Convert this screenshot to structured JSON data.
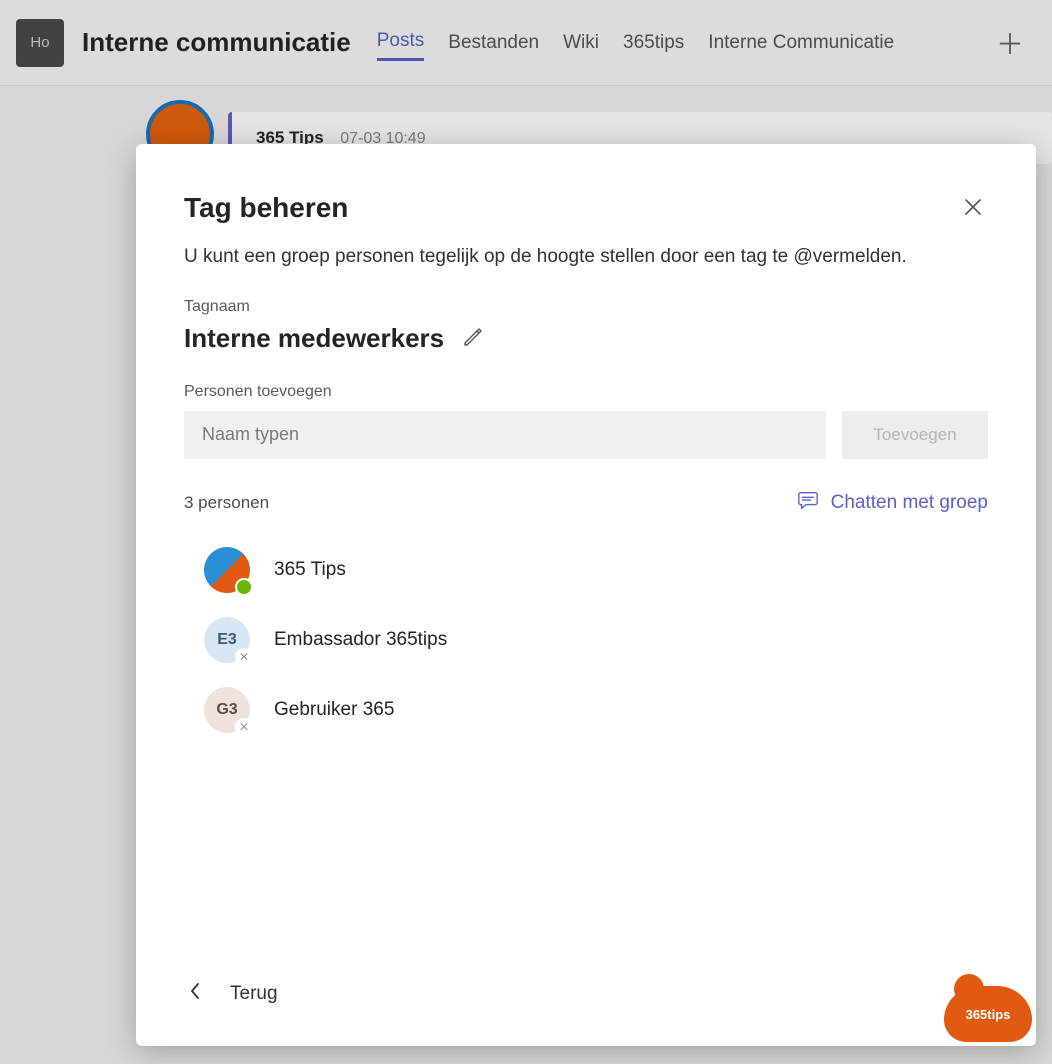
{
  "header": {
    "team_avatar_initials": "Ho",
    "channel_title": "Interne communicatie",
    "tabs": [
      "Posts",
      "Bestanden",
      "Wiki",
      "365tips",
      "Interne Communicatie"
    ],
    "active_tab_index": 0
  },
  "bg_message": {
    "author": "365 Tips",
    "timestamp": "07-03 10:49"
  },
  "modal": {
    "title": "Tag beheren",
    "subtitle": "U kunt een groep personen tegelijk op de hoogte stellen door een tag te @vermelden.",
    "tagname_label": "Tagnaam",
    "tagname_value": "Interne medewerkers",
    "add_people_label": "Personen toevoegen",
    "name_input_placeholder": "Naam typen",
    "add_button_label": "Toevoegen",
    "people_count_text": "3 personen",
    "chat_with_group_label": "Chatten met groep",
    "people": [
      {
        "name": "365 Tips",
        "initials": "",
        "avatar_class": "p-av-tips",
        "presence": "available",
        "presence_glyph": ""
      },
      {
        "name": "Embassador 365tips",
        "initials": "E3",
        "avatar_class": "p-av-e3",
        "presence": "offline",
        "presence_glyph": "✕"
      },
      {
        "name": "Gebruiker 365",
        "initials": "G3",
        "avatar_class": "p-av-g3",
        "presence": "offline",
        "presence_glyph": "✕"
      }
    ],
    "back_label": "Terug"
  },
  "brand_badge_text": "365tips"
}
